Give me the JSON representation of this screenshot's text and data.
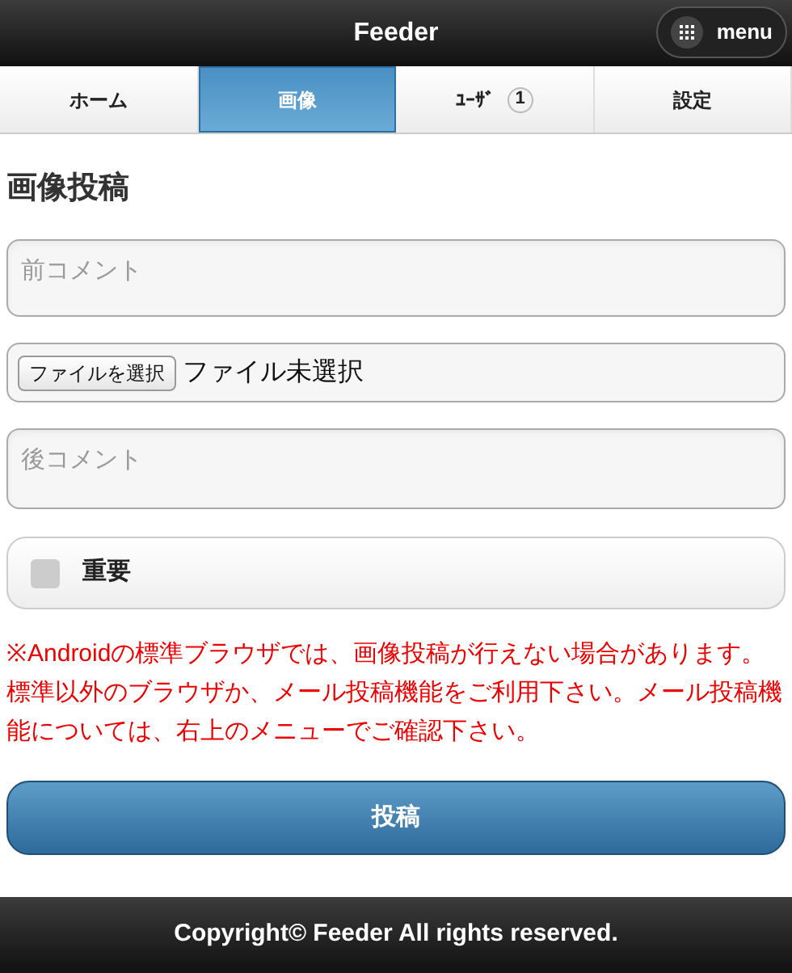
{
  "header": {
    "title": "Feeder",
    "menu_button": "menu"
  },
  "tabs": [
    {
      "label": "ホーム",
      "selected": false
    },
    {
      "label": "画像",
      "selected": true
    },
    {
      "label": "ﾕｰｻﾞ",
      "selected": false,
      "badge": "1"
    },
    {
      "label": "設定",
      "selected": false
    }
  ],
  "heading": "画像投稿",
  "before_comment": {
    "placeholder": "前コメント"
  },
  "file": {
    "button": "ファイルを選択",
    "status": "ファイル未選択"
  },
  "after_comment": {
    "placeholder": "後コメント"
  },
  "important": {
    "label": "重要",
    "checked": false
  },
  "notice": "※Androidの標準ブラウザでは、画像投稿が行えない場合があります。標準以外のブラウザか、メール投稿機能をご利用下さい。メール投稿機能については、右上のメニューでご確認下さい。",
  "submit": "投稿",
  "footer": "Copyright© Feeder All rights reserved."
}
